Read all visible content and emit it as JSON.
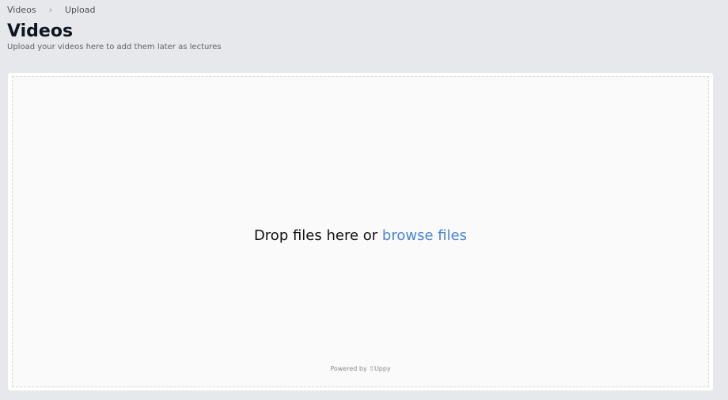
{
  "breadcrumb": {
    "items": [
      "Videos",
      "Upload"
    ],
    "separator": "›"
  },
  "page": {
    "title": "Videos",
    "subtitle": "Upload your videos here to add them later as lectures"
  },
  "dropzone": {
    "prefix": "Drop files here or ",
    "browse_label": "browse files",
    "powered_by": "Powered by",
    "brand": "Uppy",
    "brand_icon": "uppy-logo-icon",
    "link_color": "#4a84d8"
  }
}
